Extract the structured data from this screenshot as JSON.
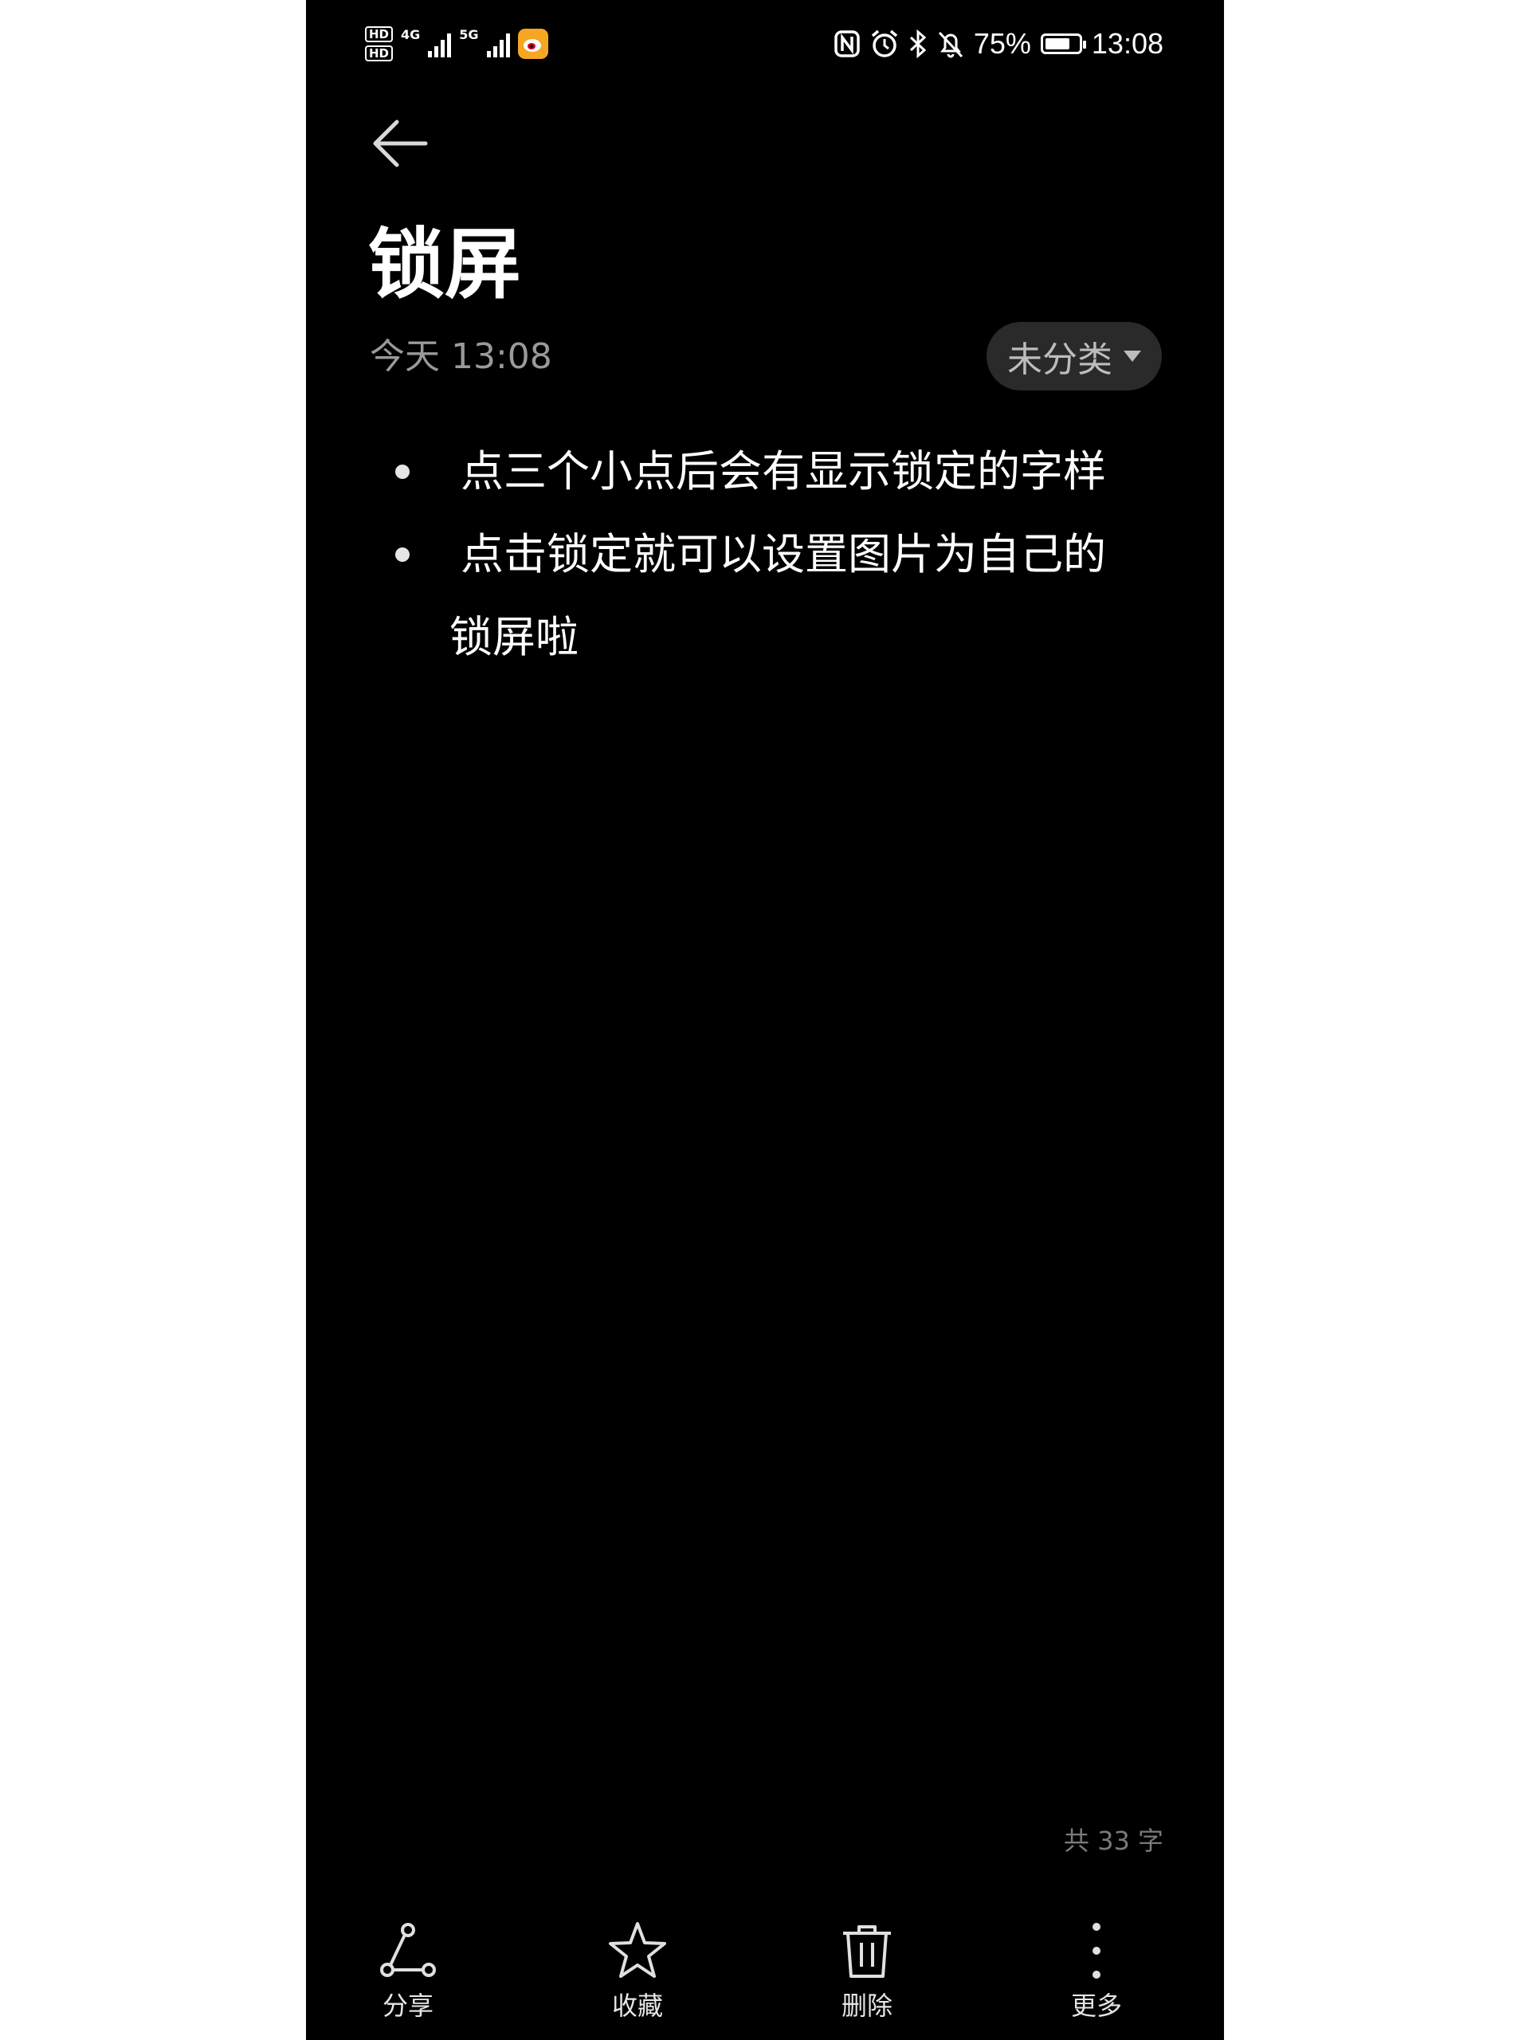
{
  "status_bar": {
    "hd_labels": [
      "HD",
      "HD"
    ],
    "network_1": "4G",
    "network_2": "5G",
    "battery_percent": "75%",
    "battery_level": 0.75,
    "time": "13:08",
    "icons": [
      "nfc-icon",
      "alarm-icon",
      "bluetooth-icon",
      "bell-muted-icon",
      "weibo-icon"
    ]
  },
  "header": {
    "back_icon": "arrow-left-icon",
    "title": "锁屏",
    "date": "今天 13:08",
    "category": "未分类"
  },
  "note": {
    "items": [
      {
        "lines": [
          "点三个小点后会有显示锁定的字样"
        ]
      },
      {
        "lines": [
          "点击锁定就可以设置图片为自己的",
          "锁屏啦"
        ]
      }
    ]
  },
  "word_count": "共 33 字",
  "toolbar": {
    "share_label": "分享",
    "favorite_label": "收藏",
    "delete_label": "删除",
    "more_label": "更多"
  },
  "colors": {
    "background": "#000000",
    "text": "#ffffff",
    "muted": "#9a9a9a",
    "chip": "#2a2a2a",
    "weibo": "#f5a623"
  }
}
